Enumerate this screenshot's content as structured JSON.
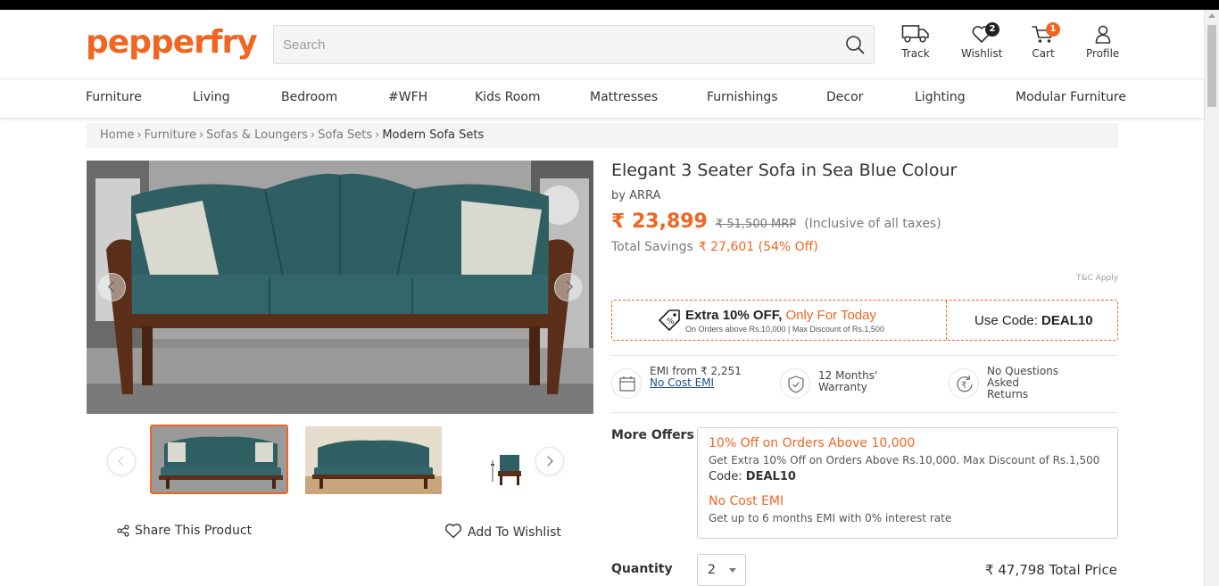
{
  "header": {
    "logo": "pepperfry",
    "search_placeholder": "Search",
    "icons": [
      {
        "label": "Track",
        "icon": "truck-icon"
      },
      {
        "label": "Wishlist",
        "icon": "heart-icon",
        "badge": "2"
      },
      {
        "label": "Cart",
        "icon": "cart-icon",
        "badge": "1"
      },
      {
        "label": "Profile",
        "icon": "user-icon"
      }
    ]
  },
  "nav": {
    "items": [
      "Furniture",
      "Living",
      "Bedroom",
      "#WFH",
      "Kids Room",
      "Mattresses",
      "Furnishings",
      "Decor",
      "Lighting",
      "Modular Furniture"
    ]
  },
  "breadcrumb": {
    "items": [
      "Home",
      "Furniture",
      "Sofas & Loungers",
      "Sofa Sets"
    ],
    "current": "Modern Sofa Sets"
  },
  "gallery": {
    "main_alt": "Elegant 3 Seater Sofa in Sea Blue Colour",
    "thumbnails": 3
  },
  "actions": {
    "share": "Share This Product",
    "wishlist": "Add To Wishlist"
  },
  "product": {
    "title": "Elegant 3 Seater Sofa in Sea Blue Colour",
    "brand": "by ARRA",
    "price": "₹ 23,899",
    "mrp": "₹ 51,500 MRP",
    "taxes": "(Inclusive of all taxes)",
    "savings_label": "Total Savings",
    "savings_amount": "₹ 27,601 (54% Off)",
    "tc": "T&C Apply"
  },
  "coupon": {
    "title_bold": "Extra 10% OFF, ",
    "title_highlight": "Only For Today",
    "subtitle": "On Orders above Rs.10,000 | Max Discount of Rs.1,500",
    "code_label": "Use Code: ",
    "code": "DEAL10"
  },
  "features": [
    {
      "line1": "EMI from ₹ 2,251",
      "link": "No Cost EMI"
    },
    {
      "line1": "12 Months'",
      "line2": "Warranty"
    },
    {
      "line1": "No Questions",
      "line2": "Asked",
      "line3": "Returns"
    }
  ],
  "more_offers": {
    "label": "More Offers",
    "offers": [
      {
        "title": "10% Off on Orders Above 10,000",
        "desc": "Get Extra 10% Off on Orders Above Rs.10,000. Max Discount of Rs.1,500",
        "code_label": "Code: ",
        "code": "DEAL10"
      },
      {
        "title": "No Cost EMI",
        "desc": "Get up to 6 months EMI with 0% interest rate"
      }
    ]
  },
  "quantity": {
    "label": "Quantity",
    "value": "2",
    "total": "₹ 47,798 Total Price"
  },
  "colors": {
    "brand": "#f16521",
    "link": "#1b4e94",
    "sofa": "#2f5f62"
  }
}
